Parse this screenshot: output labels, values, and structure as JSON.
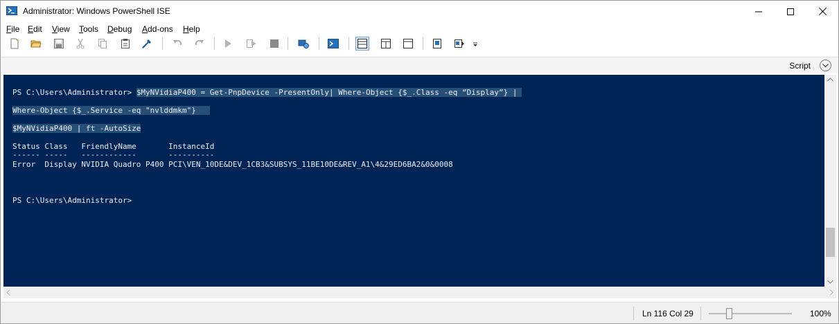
{
  "window": {
    "title": "Administrator: Windows PowerShell ISE"
  },
  "menu": {
    "items": [
      {
        "pre": "",
        "key": "F",
        "post": "ile"
      },
      {
        "pre": "",
        "key": "E",
        "post": "dit"
      },
      {
        "pre": "",
        "key": "V",
        "post": "iew"
      },
      {
        "pre": "",
        "key": "T",
        "post": "ools"
      },
      {
        "pre": "",
        "key": "D",
        "post": "ebug"
      },
      {
        "pre": "",
        "key": "A",
        "post": "dd-ons"
      },
      {
        "pre": "",
        "key": "H",
        "post": "elp"
      }
    ]
  },
  "toolbar": {
    "icons": [
      "new-file-icon",
      "open-folder-icon",
      "save-icon",
      "cut-icon",
      "copy-icon",
      "paste-icon",
      "powershell-clear-icon",
      "undo-icon",
      "redo-icon",
      "run-icon",
      "run-selection-icon",
      "stop-icon",
      "remote-powershell-icon",
      "launch-powershell-icon",
      "show-script-top-icon",
      "show-script-right-icon",
      "show-script-maximized-icon",
      "show-command-window-icon",
      "show-command-addon-icon",
      "toolbar-overflow-icon"
    ]
  },
  "script_pane": {
    "label": "Script"
  },
  "console": {
    "lines": [
      {
        "prompt": "PS C:\\Users\\Administrator> ",
        "selected": "$MyNVidiaP400 = Get-PnpDevice -PresentOnly| Where-Object {$_.Class -eq “Display”} | "
      },
      {
        "prompt": "",
        "selected": "Where-Object {$_.Service -eq \"nvlddmkm\"}   "
      },
      {
        "prompt": "",
        "selected": "$MyNVidiaP400 | ft -AutoSize"
      },
      {
        "prompt": "Status Class   FriendlyName       InstanceId",
        "selected": ""
      },
      {
        "prompt": "------ -----   ------------       ----------",
        "selected": ""
      },
      {
        "prompt": "Error  Display NVIDIA Quadro P400 PCI\\VEN_10DE&DEV_1CB3&SUBSYS_11BE10DE&REV_A1\\4&29ED6BA2&0&0008",
        "selected": ""
      },
      {
        "prompt": "PS C:\\Users\\Administrator>",
        "selected": ""
      }
    ]
  },
  "status": {
    "position": "Ln 116  Col 29",
    "zoom": "100%",
    "zoom_level": 100
  },
  "colors": {
    "console_bg": "#012456",
    "console_fg": "#eeedf0",
    "selection": "#264f78"
  }
}
